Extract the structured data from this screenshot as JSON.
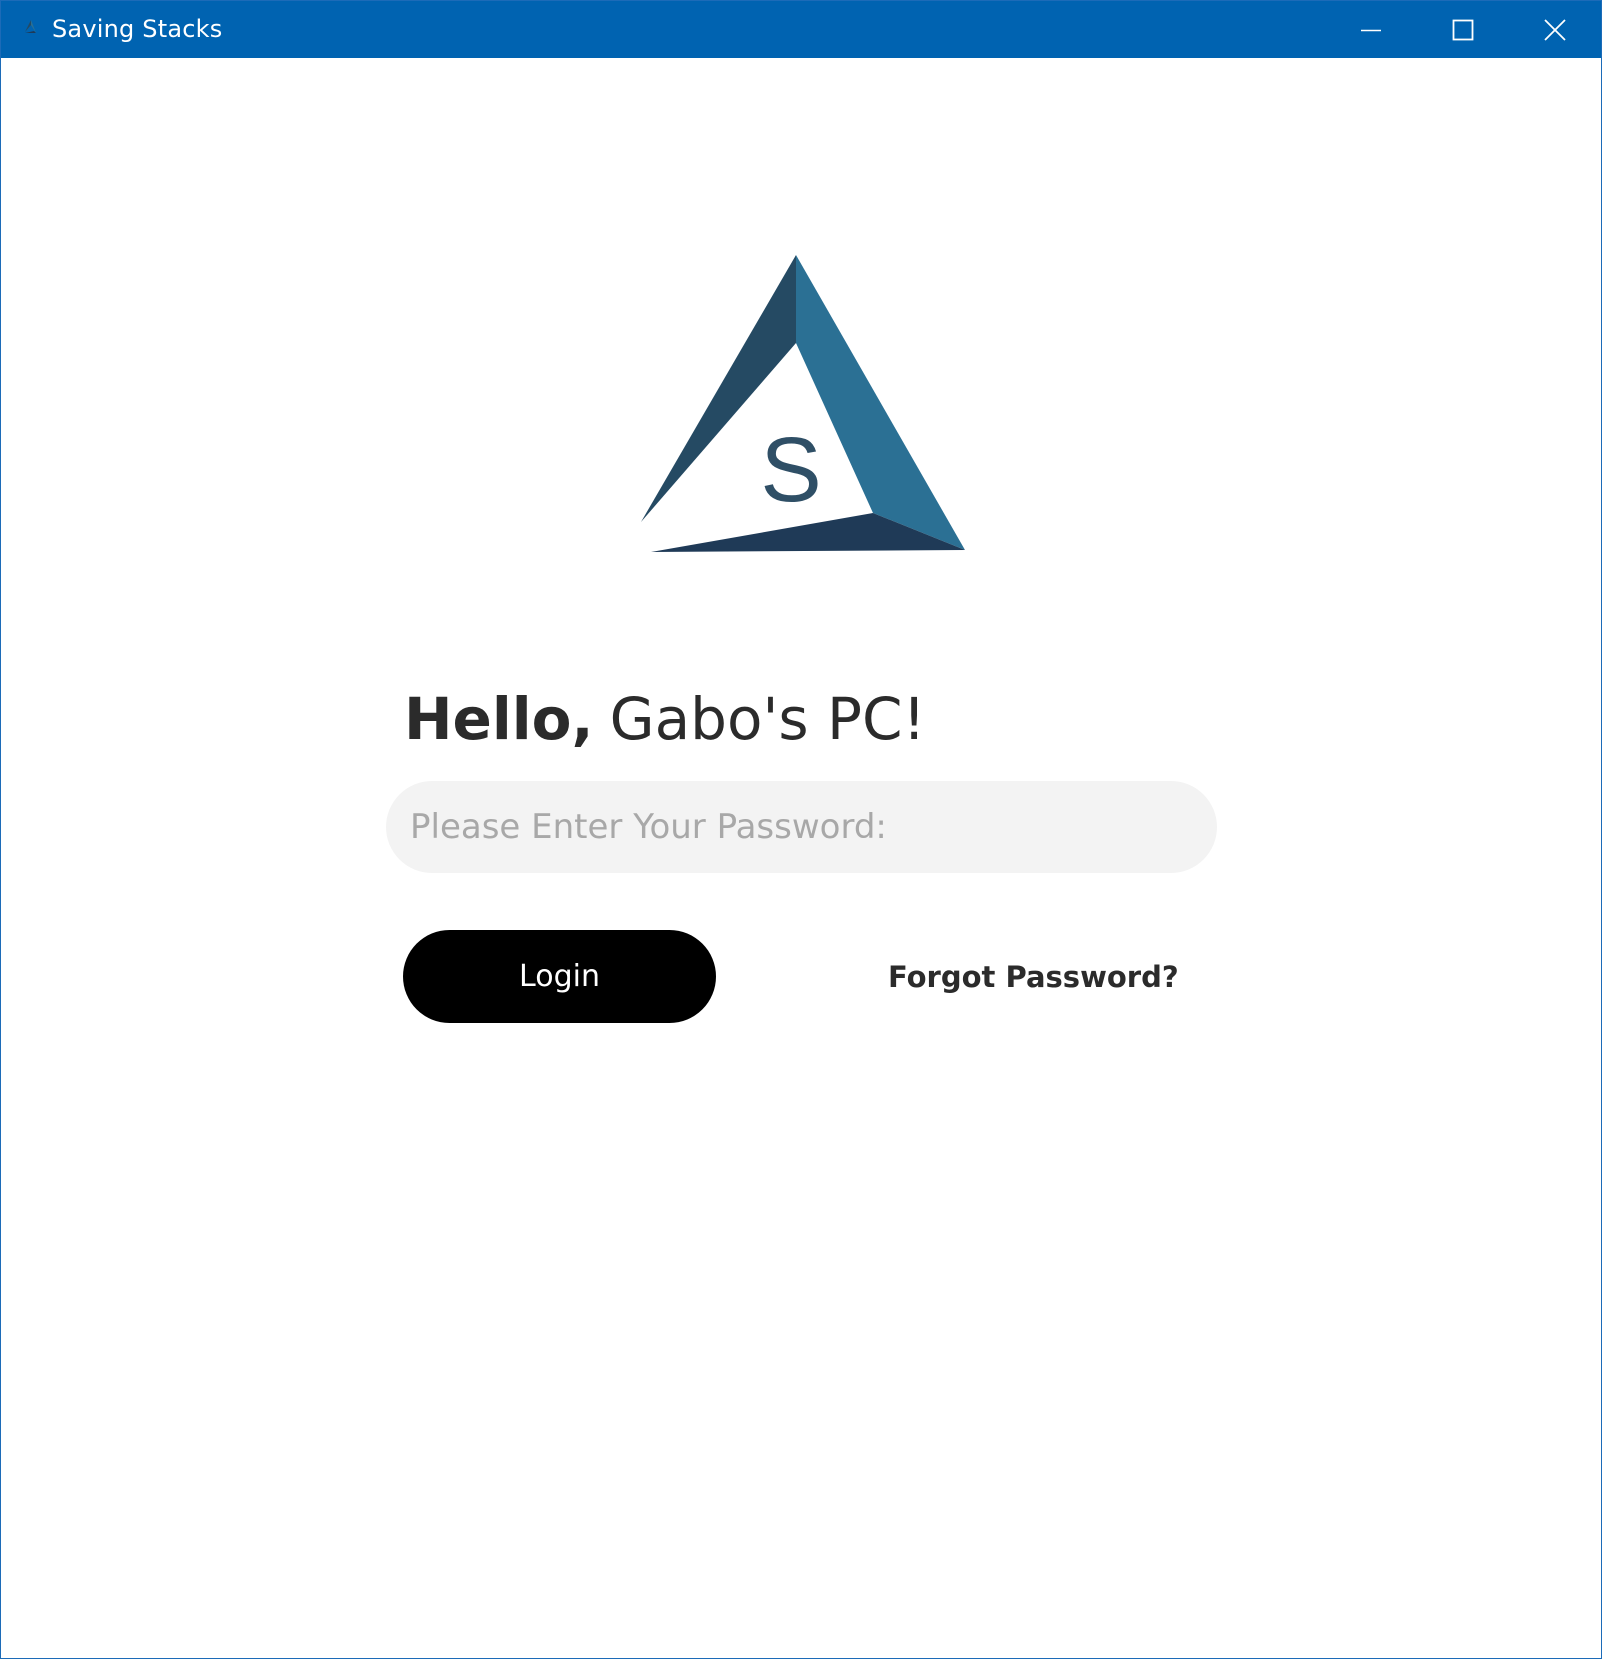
{
  "window": {
    "title": "Saving Stacks",
    "icon": "app-triangle-icon",
    "controls": {
      "minimize_icon": "minimize-icon",
      "maximize_icon": "maximize-icon",
      "close_icon": "close-icon"
    }
  },
  "logo": {
    "letter": "S",
    "colors": {
      "left_face": "#254a63",
      "right_face": "#2b7094",
      "bottom_face": "#1f3a57",
      "letter": "#2f4f66"
    }
  },
  "login": {
    "greeting_bold": "Hello,",
    "greeting_name": "Gabo's PC!",
    "password_value": "",
    "password_placeholder": "Please Enter Your Password:",
    "login_label": "Login",
    "forgot_label": "Forgot Password?"
  },
  "colors": {
    "titlebar": "#0063b1",
    "button_bg": "#000000",
    "field_bg": "#f3f3f3",
    "placeholder": "#a8a8a8",
    "text": "#2b2b2b"
  }
}
